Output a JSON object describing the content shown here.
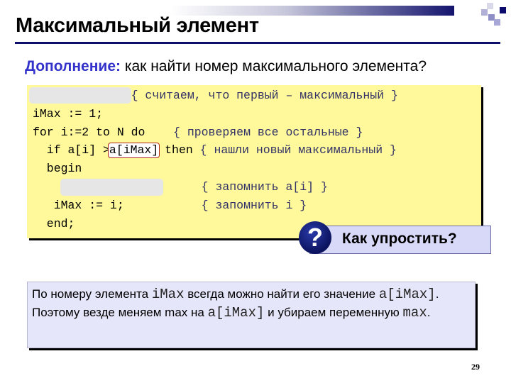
{
  "slide": {
    "title": "Максимальный элемент",
    "subtitle_lead": "Дополнение:",
    "subtitle_rest": " как найти номер максимального элемента?",
    "page_number": "29"
  },
  "code": {
    "lines": [
      {
        "code": "",
        "comment": "{ считаем, что первый – максимальный }",
        "hidden": true
      },
      {
        "code": "iMax := 1;",
        "comment": ""
      },
      {
        "code": "for i:=2 to N do",
        "comment": "{ проверяем все остальные }"
      },
      {
        "code_before": "  if a[i] >",
        "code_highlight": "a[iMax]",
        "code_after": " then",
        "comment": "{ нашли новый максимальный }"
      },
      {
        "code": "  begin",
        "comment": ""
      },
      {
        "code": "",
        "comment": "{ запомнить a[i] }",
        "hidden": true
      },
      {
        "code": "   iMax := i;",
        "comment": "{ запомнить i }"
      },
      {
        "code": "  end;",
        "comment": ""
      }
    ]
  },
  "callout": {
    "icon": "question-icon",
    "icon_glyph": "?",
    "text": "Как упростить?"
  },
  "answer": {
    "parts": [
      {
        "t": "По номеру элемента ",
        "mono": false
      },
      {
        "t": "iMax",
        "mono": true
      },
      {
        "t": " всегда можно найти его значение ",
        "mono": false
      },
      {
        "t": "a[iMax]",
        "mono": true
      },
      {
        "t": ". Поэтому везде меняем max на ",
        "mono": false
      },
      {
        "t": "a[iMax]",
        "mono": true
      },
      {
        "t": " и убираем переменную ",
        "mono": false
      },
      {
        "t": "max",
        "mono": true
      },
      {
        "t": ".",
        "mono": false
      }
    ]
  },
  "colors": {
    "title_rule": "#0d0d6b",
    "subtitle_lead": "#3333cc",
    "code_bg": "#fff99c",
    "answer_bg": "#e6e6fa",
    "highlight_border": "#b02a1a"
  }
}
